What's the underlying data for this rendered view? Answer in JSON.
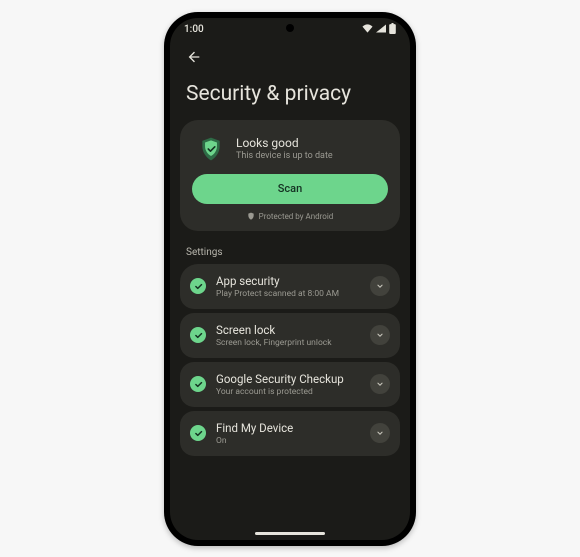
{
  "colors": {
    "accent": "#6dd58c",
    "shield_outer": "#2e6b46",
    "expand_bg": "#42423c"
  },
  "statusbar": {
    "time": "1:00"
  },
  "page": {
    "title": "Security & privacy"
  },
  "status_card": {
    "title": "Looks good",
    "subtitle": "This device is up to date",
    "button_label": "Scan",
    "footer": "Protected by Android"
  },
  "sections": {
    "settings_label": "Settings"
  },
  "settings": [
    {
      "title": "App security",
      "subtitle": "Play Protect scanned at 8:00 AM"
    },
    {
      "title": "Screen lock",
      "subtitle": "Screen lock, Fingerprint unlock"
    },
    {
      "title": "Google Security Checkup",
      "subtitle": "Your account is protected"
    },
    {
      "title": "Find My Device",
      "subtitle": "On"
    }
  ]
}
